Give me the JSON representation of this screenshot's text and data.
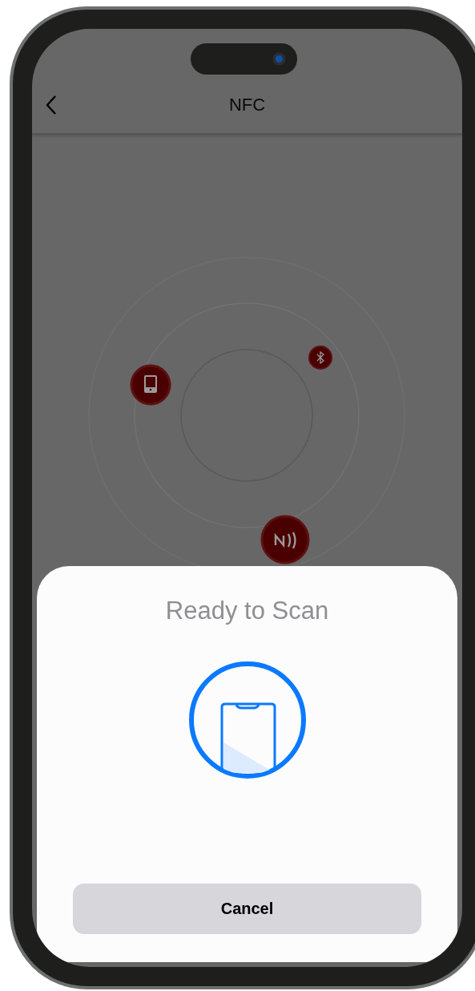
{
  "nav_bar": {
    "title": "NFC"
  },
  "scan_sheet": {
    "title": "Ready to Scan",
    "cancel_button": "Cancel"
  }
}
